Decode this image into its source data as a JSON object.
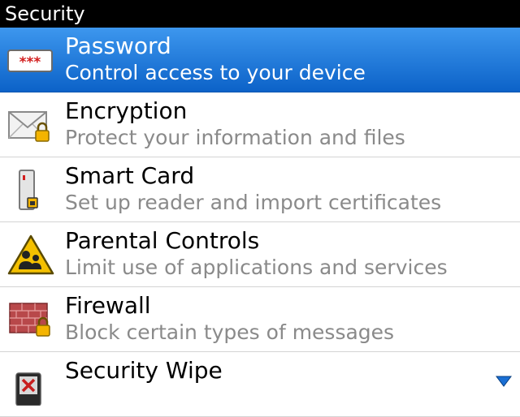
{
  "window": {
    "title": "Security"
  },
  "items": [
    {
      "title": "Password",
      "subtitle": "Control access to your device",
      "icon": "password-icon",
      "selected": true
    },
    {
      "title": "Encryption",
      "subtitle": "Protect your information and files",
      "icon": "envelope-lock-icon"
    },
    {
      "title": "Smart Card",
      "subtitle": "Set up reader and import certificates",
      "icon": "smart-card-icon"
    },
    {
      "title": "Parental Controls",
      "subtitle": "Limit use of applications and services",
      "icon": "parental-warning-icon"
    },
    {
      "title": "Firewall",
      "subtitle": "Block certain types of messages",
      "icon": "brick-wall-lock-icon"
    },
    {
      "title": "Security Wipe",
      "subtitle": "",
      "icon": "wipe-icon"
    }
  ],
  "password_icon_text": "***",
  "colors": {
    "selection": "#0c62c8",
    "subtitle": "#8a8a8a",
    "titlebar": "#000000"
  }
}
